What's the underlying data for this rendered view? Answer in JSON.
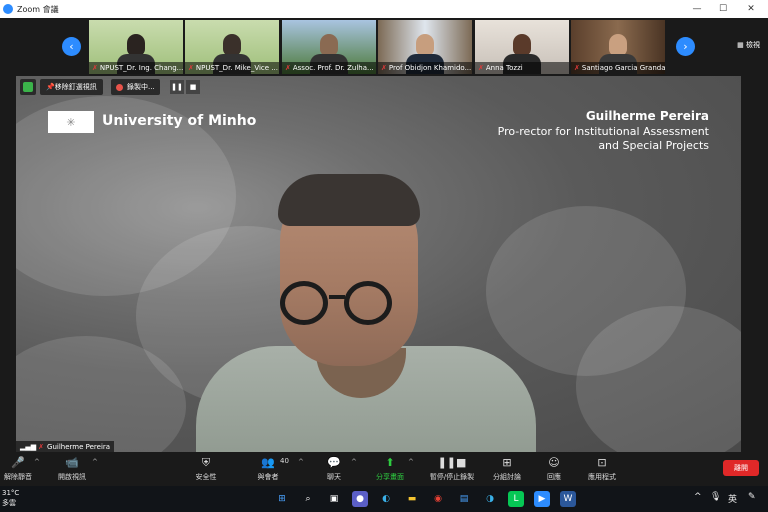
{
  "window": {
    "title": "Zoom 會議",
    "minimize_glyph": "—",
    "maximize_glyph": "☐",
    "close_glyph": "✕"
  },
  "gallery": {
    "prev_glyph": "‹",
    "next_glyph": "›",
    "view_label": "檢視",
    "participants": [
      {
        "name": "NPUST_Dr. Ing. Chang...",
        "bg": "#9fbf7a",
        "muted": true
      },
      {
        "name": "NPUST_Dr. Mike_Vice ...",
        "bg": "#9fbf7a",
        "muted": true
      },
      {
        "name": "Assoc. Prof. Dr. Zulha...",
        "bg": "#6e8db3",
        "muted": true
      },
      {
        "name": "Prof Obidjon Khamido...",
        "bg": "#5c6f86",
        "muted": true
      },
      {
        "name": "Anna Tozzi",
        "bg": "#c8c0b8",
        "muted": true
      },
      {
        "name": "Santiago Garcia Granda",
        "bg": "#6b4e3a",
        "muted": true
      }
    ]
  },
  "overlay": {
    "spotlight_label": "移除釘選視訊",
    "recording_label": "錄製中...",
    "pause_glyph": "❚❚",
    "stop_glyph": "■"
  },
  "slide": {
    "institution": "University of Minho",
    "speaker_name": "Guilherme Pereira",
    "speaker_role_line1": "Pro-rector for Institutional Assessment",
    "speaker_role_line2": "and Special Projects"
  },
  "active_speaker": {
    "name": "Guilherme Pereira"
  },
  "toolbar": {
    "items": [
      {
        "label": "解除靜音",
        "icon": "mic-muted-icon"
      },
      {
        "label": "開啟視訊",
        "icon": "video-off-icon"
      },
      {
        "label": "安全性",
        "icon": "shield-icon"
      },
      {
        "label": "與會者",
        "icon": "participants-icon"
      },
      {
        "label": "聊天",
        "icon": "chat-icon"
      },
      {
        "label": "分享畫面",
        "icon": "share-screen-icon"
      },
      {
        "label": "暫停/停止錄製",
        "icon": "record-controls-icon"
      },
      {
        "label": "分組討論",
        "icon": "breakout-rooms-icon"
      },
      {
        "label": "回應",
        "icon": "reactions-icon"
      },
      {
        "label": "應用程式",
        "icon": "apps-icon"
      }
    ],
    "participant_count": "40",
    "end_label": "離開"
  },
  "taskbar": {
    "temperature": "31°C",
    "weather_desc": "多雲",
    "lang": "英",
    "colors": {
      "accent": "#2d8cff",
      "end": "#e02828",
      "share": "#2ecc40"
    }
  }
}
